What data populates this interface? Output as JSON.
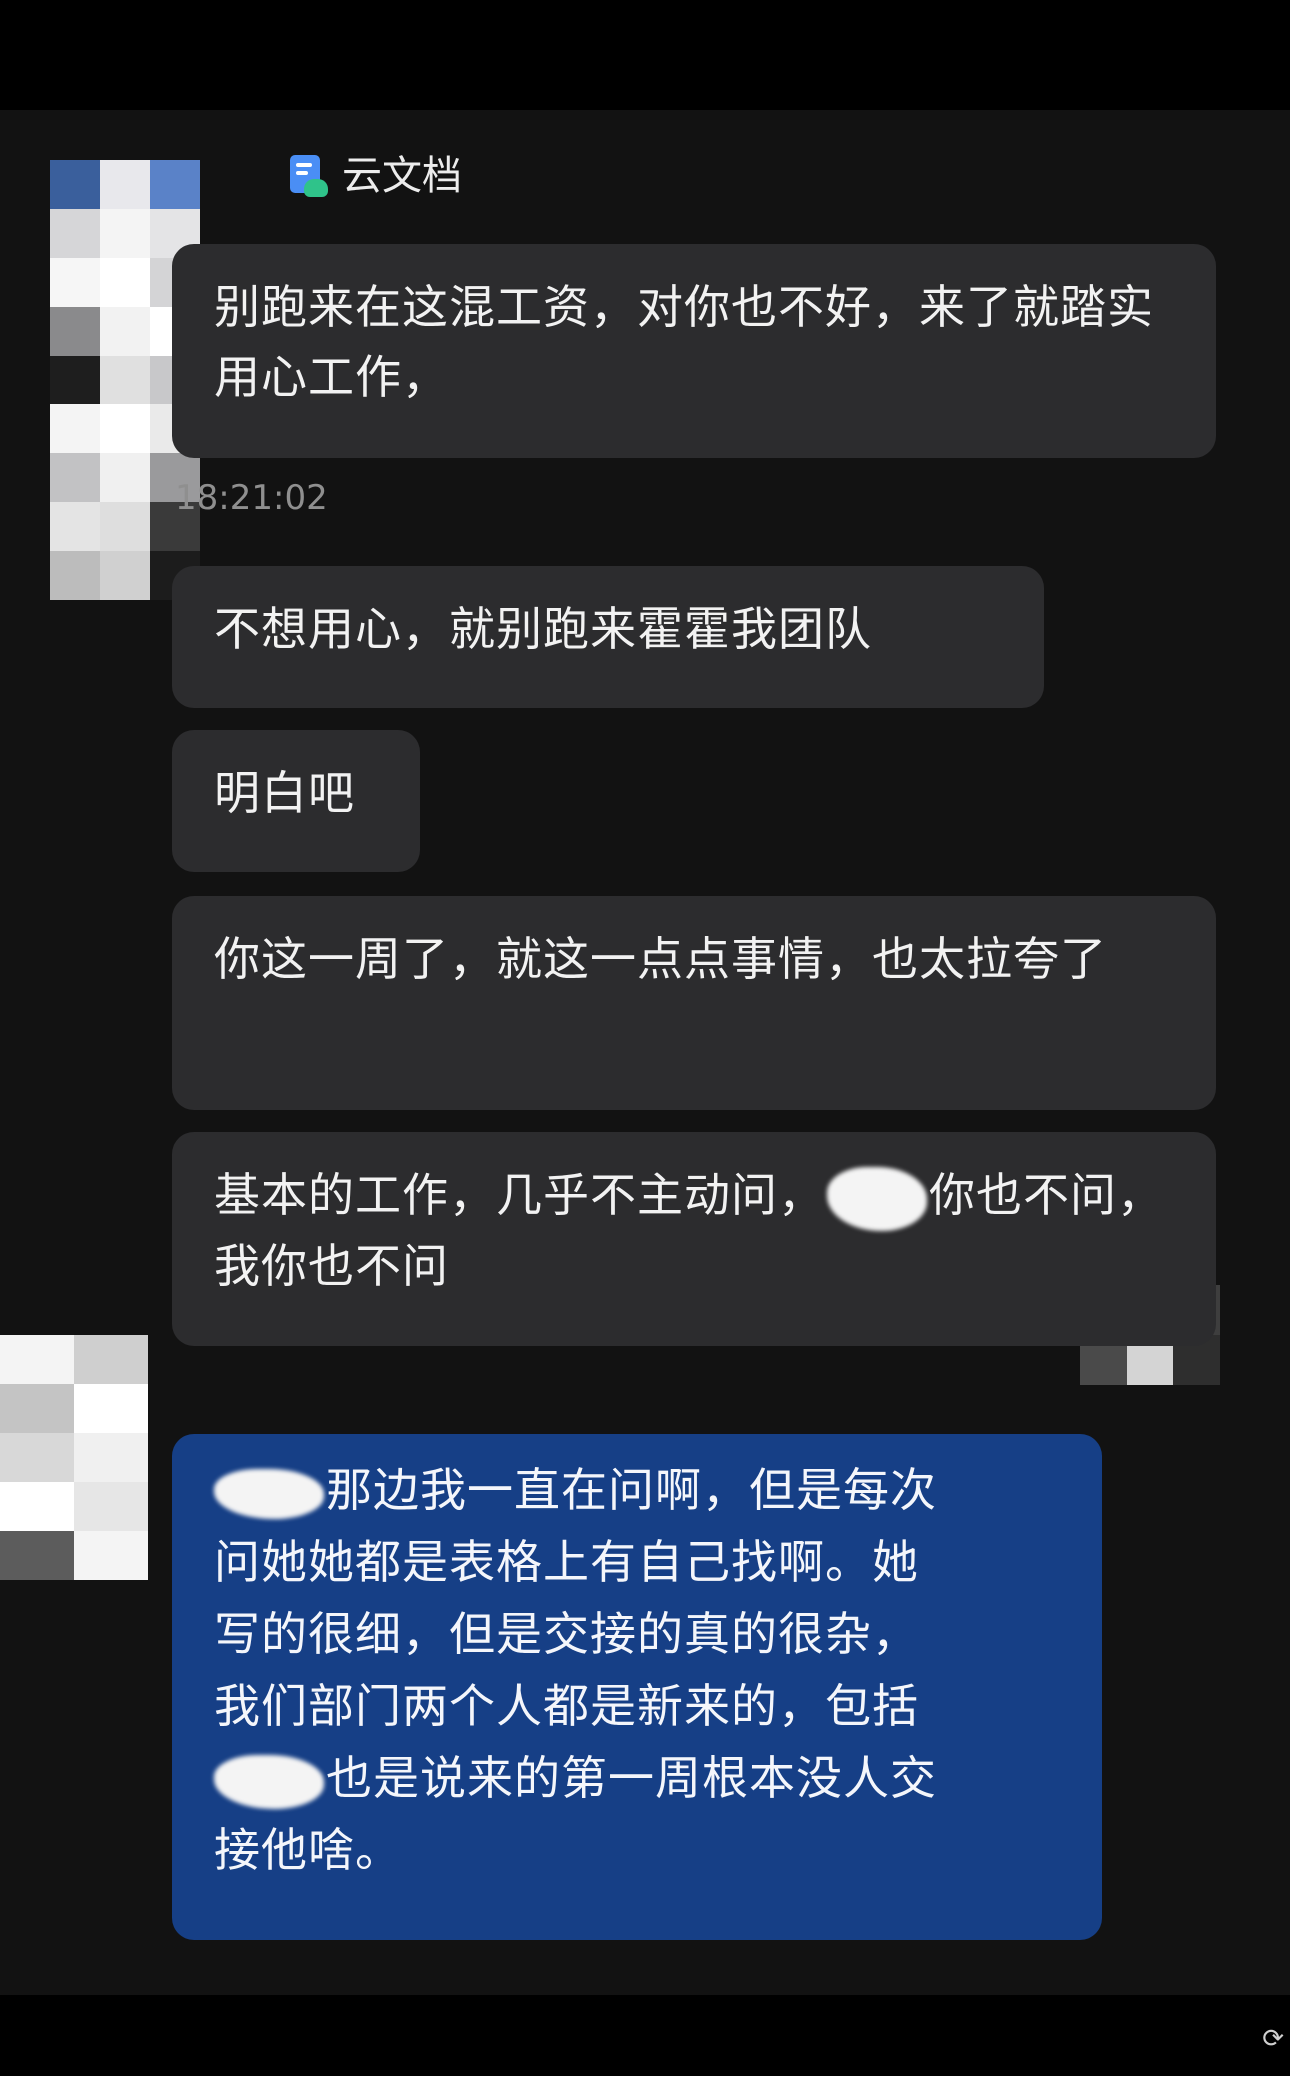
{
  "app": {
    "doc_label": "云文档",
    "doc_icon": "cloud-doc-icon"
  },
  "messages": [
    {
      "id": "m1",
      "side": "incoming",
      "text": "别跑来在这混工资，对你也不好，来了就踏实用心工作，"
    },
    {
      "id": "m1_time",
      "timestamp": "18:21:02"
    },
    {
      "id": "m2",
      "side": "incoming",
      "text": "不想用心，就别跑来霍霍我团队"
    },
    {
      "id": "m3",
      "side": "incoming",
      "text": "明白吧"
    },
    {
      "id": "m4",
      "side": "incoming",
      "text": "你这一周了，就这一点点事情，也太拉夸了"
    },
    {
      "id": "m5",
      "side": "incoming",
      "text_before": "基本的工作，几乎不主动问，",
      "text_after": "你也不问，我你也不问"
    },
    {
      "id": "m6",
      "side": "outgoing",
      "line1_after": "那边我一直在问啊，但是每次",
      "line2": "问她她都是表格上有自己找啊。她",
      "line3": "写的很细，但是交接的真的很杂，",
      "line4": "我们部门两个人都是新来的，包括",
      "line5_after": "也是说来的第一周根本没人交",
      "line6": "接他啥。"
    }
  ],
  "colors": {
    "background": "#121212",
    "incoming_bubble": "#2c2c2e",
    "outgoing_bubble": "#163f86",
    "text": "#f2f2f2",
    "timestamp": "#8f8f8f"
  }
}
